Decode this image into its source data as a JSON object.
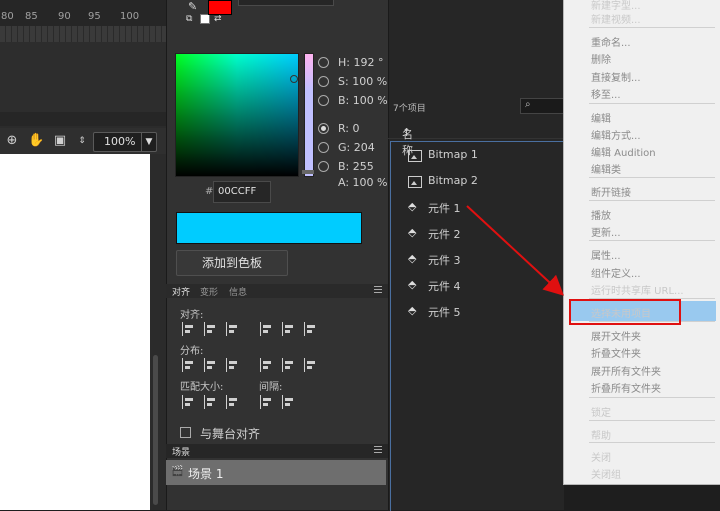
{
  "timeline": {
    "ruler_labels": [
      "80",
      "85",
      "90",
      "95",
      "100"
    ],
    "zoom": "100%"
  },
  "color_panel": {
    "values": [
      {
        "label": "H:",
        "value": "192 °",
        "selected": false
      },
      {
        "label": "S:",
        "value": "100 %",
        "selected": false
      },
      {
        "label": "B:",
        "value": "100 %",
        "selected": false
      },
      {
        "label": "R:",
        "value": "0",
        "selected": true
      },
      {
        "label": "G:",
        "value": "204",
        "selected": false
      },
      {
        "label": "B:",
        "value": "255",
        "selected": false
      },
      {
        "label": "A:",
        "value": "100 %",
        "selected": false
      }
    ],
    "hex_prefix": "#",
    "hex": "00CCFF",
    "current_color": "#00ccff",
    "top_swatch_color": "#ff0000",
    "add_button": "添加到色板"
  },
  "align_panel": {
    "tabs": [
      "对齐",
      "变形",
      "信息"
    ],
    "align_label": "对齐:",
    "distribute_label": "分布:",
    "match_size_label": "匹配大小:",
    "spacing_label": "间隔:",
    "stage_align": "与舞台对齐"
  },
  "scene_panel": {
    "header": "场景",
    "row": "场景 1"
  },
  "library": {
    "count": "7个项目",
    "search_icon": "⌕",
    "column_name": "名称",
    "sort_icon": "↑",
    "items": [
      {
        "icon": "bitmap-icon",
        "name": "Bitmap 1"
      },
      {
        "icon": "bitmap-icon",
        "name": "Bitmap 2"
      },
      {
        "icon": "symbol-icon",
        "name": "元件 1"
      },
      {
        "icon": "symbol-icon",
        "name": "元件 2"
      },
      {
        "icon": "symbol-icon",
        "name": "元件 3"
      },
      {
        "icon": "symbol-icon",
        "name": "元件 4"
      },
      {
        "icon": "symbol-icon",
        "name": "元件 5"
      }
    ]
  },
  "context_menu": {
    "items": [
      {
        "label": "新建字型...",
        "disabled": false
      },
      {
        "label": "新建视频...",
        "disabled": false
      },
      {
        "label": "重命名...",
        "disabled": true
      },
      {
        "label": "删除",
        "disabled": true
      },
      {
        "label": "直接复制...",
        "disabled": true
      },
      {
        "label": "移至...",
        "disabled": true
      },
      {
        "label": "编辑",
        "disabled": true
      },
      {
        "label": "编辑方式...",
        "disabled": true
      },
      {
        "label": "编辑 Audition",
        "disabled": true
      },
      {
        "label": "编辑类",
        "disabled": true
      },
      {
        "label": "断开链接",
        "disabled": true
      },
      {
        "label": "播放",
        "disabled": true
      },
      {
        "label": "更新...",
        "disabled": true
      },
      {
        "label": "属性...",
        "disabled": true
      },
      {
        "label": "组件定义...",
        "disabled": true
      },
      {
        "label": "运行时共享库 URL...",
        "disabled": false
      },
      {
        "label": "选择未用项目",
        "disabled": false,
        "highlighted": true
      },
      {
        "label": "展开文件夹",
        "disabled": true
      },
      {
        "label": "折叠文件夹",
        "disabled": true
      },
      {
        "label": "展开所有文件夹",
        "disabled": true
      },
      {
        "label": "折叠所有文件夹",
        "disabled": true
      },
      {
        "label": "锁定",
        "disabled": false
      },
      {
        "label": "帮助",
        "disabled": false
      },
      {
        "label": "关闭",
        "disabled": false
      },
      {
        "label": "关闭组",
        "disabled": false
      }
    ]
  },
  "annotation": {
    "arrow_color": "#e01010",
    "highlight_box_color": "#e01010"
  }
}
